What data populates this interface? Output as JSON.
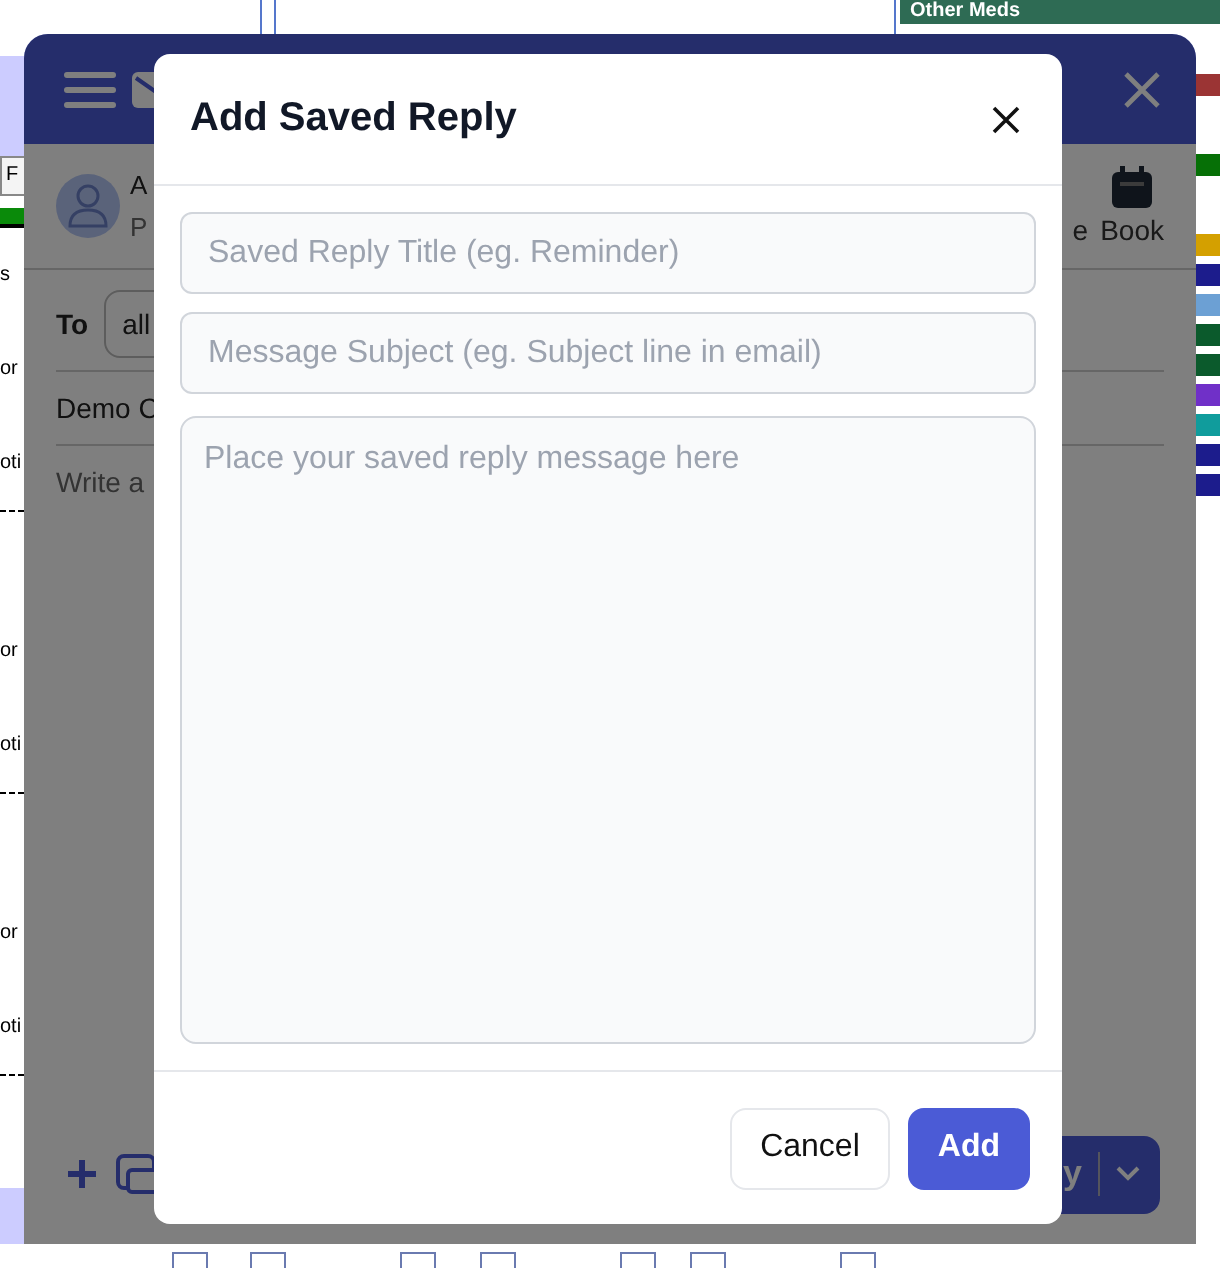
{
  "background": {
    "header_label": "Other Meds",
    "left_fragments": [
      {
        "kind": "field",
        "text": "F"
      },
      {
        "kind": "bar"
      },
      {
        "kind": "text",
        "text": "s"
      },
      {
        "kind": "text",
        "text": "or"
      },
      {
        "kind": "text",
        "text": "oti"
      },
      {
        "kind": "rule"
      },
      {
        "kind": "text",
        "text": "or"
      },
      {
        "kind": "text",
        "text": "oti"
      },
      {
        "kind": "rule"
      },
      {
        "kind": "text",
        "text": "or"
      },
      {
        "kind": "text",
        "text": "oti"
      },
      {
        "kind": "rule"
      }
    ],
    "right_bars": [
      {
        "color": "#9b3434"
      },
      {
        "color": "#067006"
      },
      {
        "color": "#d4a000"
      },
      {
        "color": "#1c1c8c"
      },
      {
        "color": "#6ca0d4"
      },
      {
        "color": "#0b5a2c"
      },
      {
        "color": "#0b5a2c"
      },
      {
        "color": "#7030c8"
      },
      {
        "color": "#109c9c"
      },
      {
        "color": "#1c1c8c"
      },
      {
        "color": "#1c1c8c"
      }
    ]
  },
  "panel": {
    "contact_name": "A",
    "contact_sub": "P",
    "actions": [
      {
        "label": "e"
      },
      {
        "label": "Book"
      }
    ],
    "to_label": "To",
    "to_value": "all",
    "subject": "Demo C",
    "body_placeholder": "Write a",
    "reply_button": "y"
  },
  "modal": {
    "title": "Add Saved Reply",
    "fields": [
      {
        "kind": "input",
        "placeholder": "Saved Reply Title (eg. Reminder)"
      },
      {
        "kind": "input",
        "placeholder": "Message Subject (eg. Subject line in email)"
      },
      {
        "kind": "textarea",
        "placeholder": "Place your saved reply message here"
      }
    ],
    "buttons": [
      {
        "kind": "secondary",
        "label": "Cancel"
      },
      {
        "kind": "primary",
        "label": "Add"
      }
    ]
  }
}
